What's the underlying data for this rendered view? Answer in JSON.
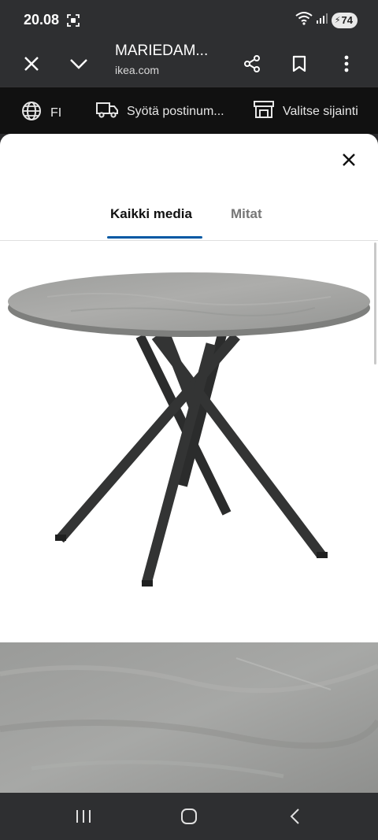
{
  "status_bar": {
    "time": "20.08",
    "battery_level": "74"
  },
  "browser": {
    "page_title": "MARIEDAM...",
    "domain": "ikea.com",
    "icons": [
      "close-icon",
      "chevron-down-icon",
      "share-icon",
      "bookmark-icon",
      "more-vert-icon"
    ]
  },
  "context_bar": {
    "language": "FI",
    "postcode": "Syötä postinum...",
    "store": "Valitse sijainti"
  },
  "media_modal": {
    "tabs": [
      {
        "label": "Kaikki media",
        "active": true
      },
      {
        "label": "Mitat",
        "active": false
      }
    ],
    "images": [
      {
        "subject": "round table with grey concrete-effect top and crossed black legs"
      },
      {
        "subject": "close-up of grey stone-effect tabletop surface"
      }
    ]
  },
  "colors": {
    "system_bar": "#2e2f31",
    "context_bar": "#111111",
    "tab_underline": "#0058a3",
    "tabletop": "#a3a4a2",
    "legs": "#2b2c2c"
  },
  "nav_bar": {
    "icons": [
      "recent-apps-icon",
      "home-icon",
      "back-icon"
    ]
  }
}
